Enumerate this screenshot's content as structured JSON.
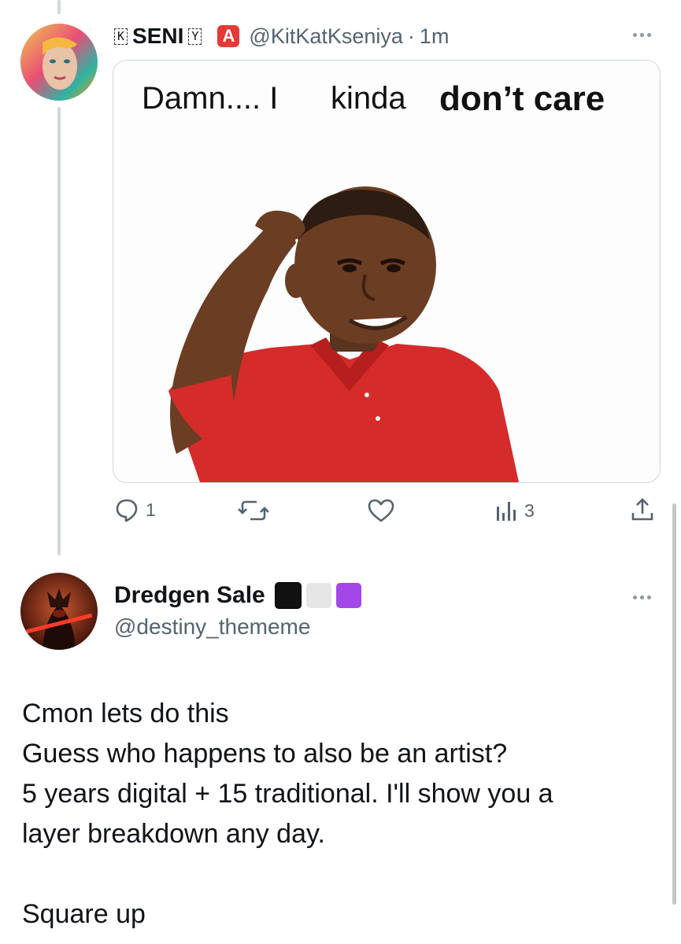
{
  "tweet1": {
    "display_name": "SENI",
    "name_prefix_tag": "K",
    "name_suffix_tag": "Y",
    "badge_letter": "A",
    "handle": "@KitKatKseniya",
    "separator": "·",
    "time": "1m",
    "meme": {
      "line1": "Damn.... I",
      "line2": "kinda",
      "line3": "don’t care"
    },
    "actions": {
      "replies": "1",
      "reposts": "",
      "likes": "",
      "views": "3"
    }
  },
  "tweet2": {
    "display_name": "Dredgen Sale",
    "handle": "@destiny_thememe",
    "name_squares": [
      "black-square",
      "white-square",
      "purple-square"
    ],
    "body_lines": [
      "Cmon lets do this",
      "Guess who happens to also be an artist?",
      "5 years digital + 15 traditional. I'll show you a",
      "layer breakdown any day.",
      "",
      "Square up"
    ]
  },
  "colors": {
    "accent_purple": "#a347e8",
    "action_gray": "#536471",
    "border": "#cfd9de",
    "badge_red": "#e53935"
  }
}
